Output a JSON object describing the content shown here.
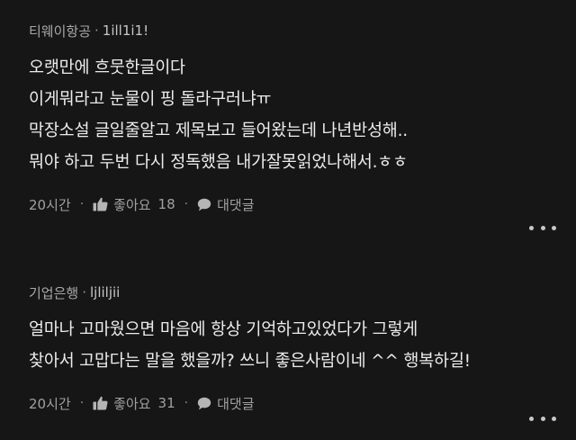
{
  "comments": [
    {
      "author": "티웨이항공",
      "separator": "·",
      "handle": "1ill1i1!",
      "lines": [
        "오랫만에 흐뭇한글이다",
        "이게뭐라고 눈물이 핑 돌라구러냐ㅠ",
        "막장소설 글일줄알고 제목보고 들어왔는데 나년반성해..",
        "뭐야 하고 두번 다시 정독했음 내가잘못읽었나해서.ㅎㅎ"
      ],
      "time": "20시간",
      "like_label": "좋아요",
      "like_count": "18",
      "reply_label": "대댓글",
      "dot": "·"
    },
    {
      "author": "기업은행",
      "separator": "·",
      "handle": "ljliljii",
      "lines": [
        "얼마나 고마웠으면 마음에 항상 기억하고있었다가 그렇게",
        "찾아서 고맙다는 말을 했을까? 쓰니 좋은사람이네 ^^ 행복하길!"
      ],
      "time": "20시간",
      "like_label": "좋아요",
      "like_count": "31",
      "reply_label": "대댓글",
      "dot": "·"
    }
  ],
  "icons": {
    "like": "thumbs-up-icon",
    "reply": "speech-bubble-icon",
    "more": "more-dots-icon"
  }
}
